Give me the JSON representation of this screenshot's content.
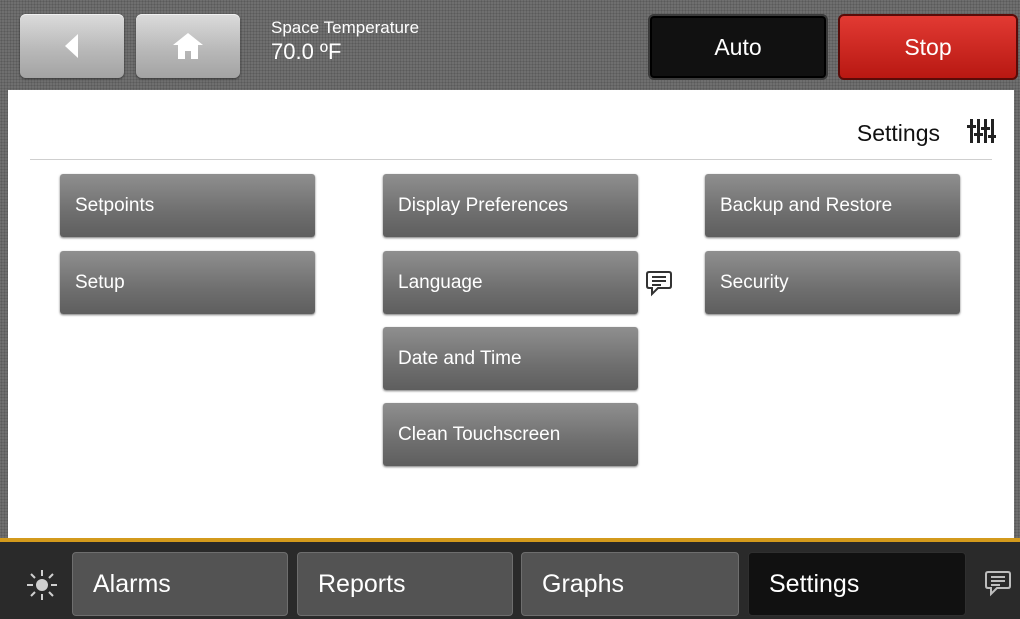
{
  "header": {
    "temperature_label": "Space Temperature",
    "temperature_value": "70.0 ºF",
    "mode_button": "Auto",
    "stop_button": "Stop"
  },
  "panel": {
    "title": "Settings",
    "columns": [
      [
        "Setpoints",
        "Setup"
      ],
      [
        "Display Preferences",
        "Language",
        "Date and Time",
        "Clean Touchscreen"
      ],
      [
        "Backup and Restore",
        "Security"
      ]
    ]
  },
  "bottom_tabs": [
    "Alarms",
    "Reports",
    "Graphs",
    "Settings"
  ],
  "icons": [
    "back-arrow-icon",
    "home-icon",
    "settings-sliders-icon",
    "chat-bubble-icon",
    "brightness-icon"
  ],
  "colors": {
    "accent_gold": "#d39a1c",
    "stop_red": "#c9231c",
    "active_tab": "#111111"
  }
}
